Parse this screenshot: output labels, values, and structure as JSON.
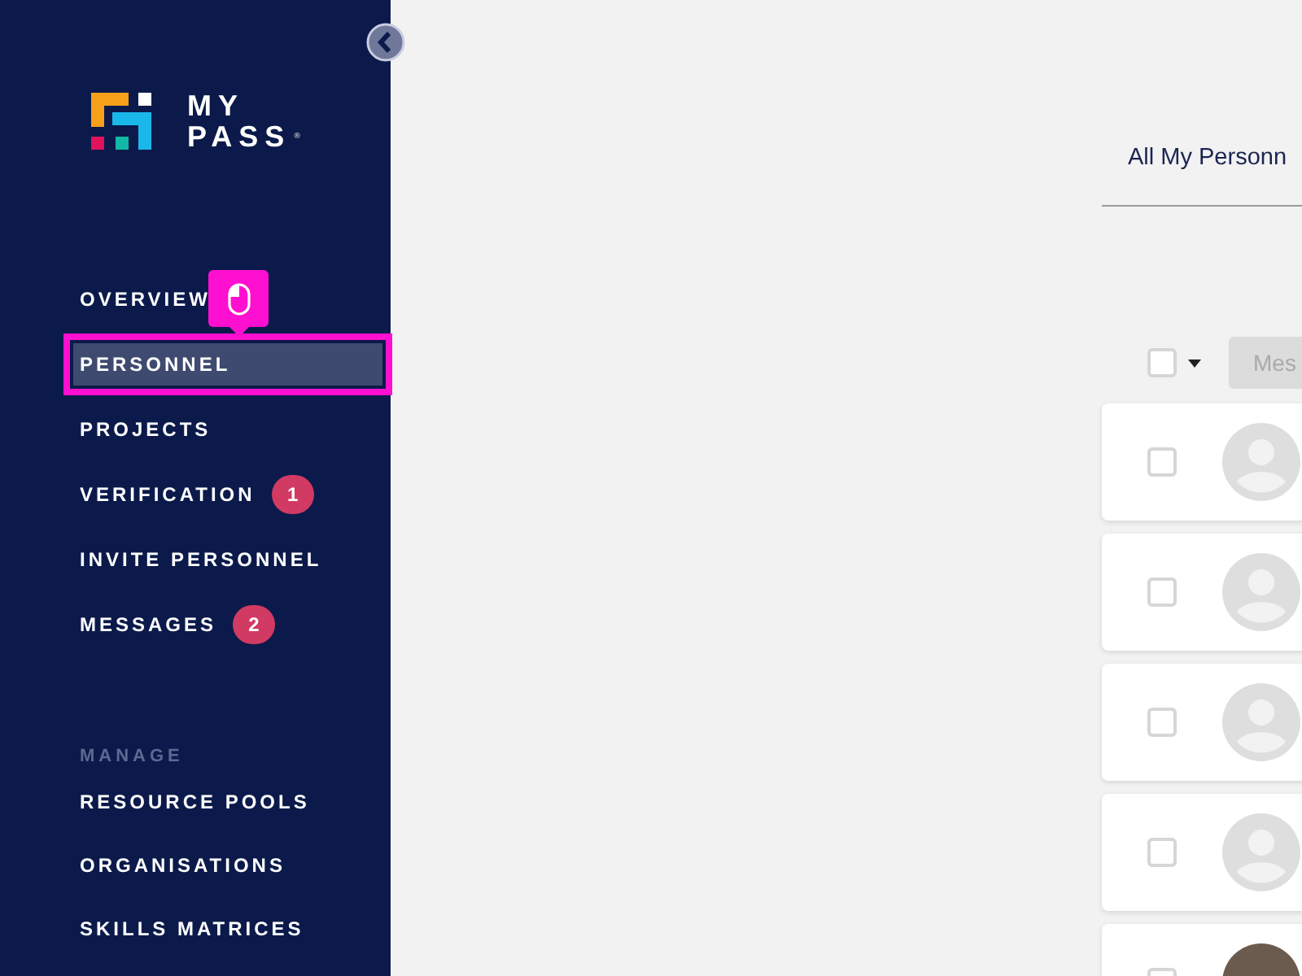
{
  "logo": {
    "line_1": "MY",
    "line_2": "PASS",
    "mark": "®"
  },
  "nav": [
    {
      "label": "OVERVIEW",
      "selected": false
    },
    {
      "label": "PERSONNEL",
      "selected": true
    },
    {
      "label": "PROJECTS",
      "selected": false
    },
    {
      "label": "VERIFICATION",
      "selected": false,
      "badge": "1"
    },
    {
      "label": "INVITE PERSONNEL",
      "selected": false
    },
    {
      "label": "MESSAGES",
      "selected": false,
      "badge": "2"
    }
  ],
  "manage": {
    "heading": "MANAGE",
    "items": [
      {
        "label": "RESOURCE POOLS",
        "selected": false
      },
      {
        "label": "ORGANISATIONS",
        "selected": false
      },
      {
        "label": "SKILLS MATRICES",
        "selected": false
      }
    ]
  },
  "tab": {
    "label": "All My Personn"
  },
  "toolbar": {
    "select_all": {
      "checked": false
    },
    "button": "Mes"
  },
  "rows": [
    {
      "checked": false,
      "kind": "placeholder"
    },
    {
      "checked": false,
      "kind": "placeholder"
    },
    {
      "checked": false,
      "kind": "placeholder"
    },
    {
      "checked": false,
      "kind": "placeholder"
    },
    {
      "checked": false,
      "kind": "photo"
    }
  ]
}
